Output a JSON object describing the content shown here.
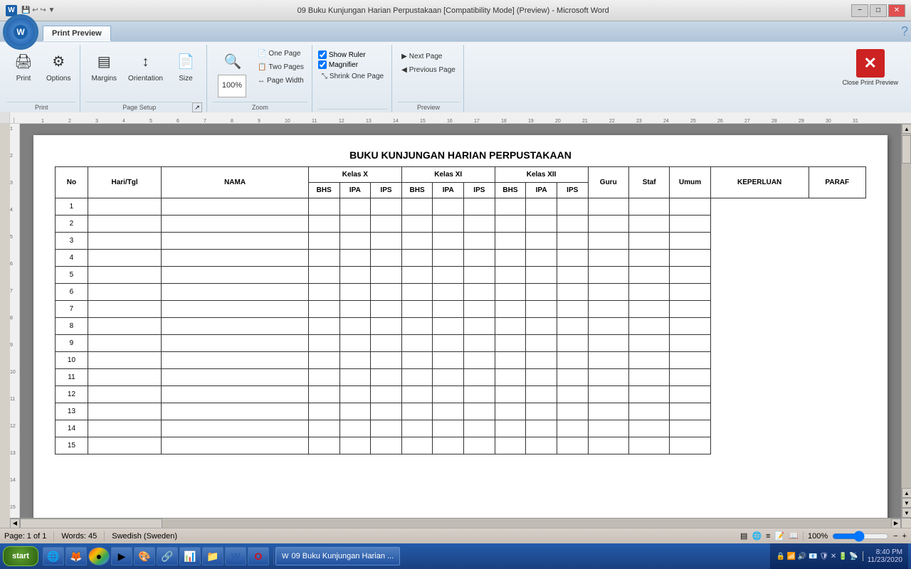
{
  "window": {
    "title": "09 Buku Kunjungan Harian Perpustakaan [Compatibility Mode] (Preview) - Microsoft Word",
    "min_label": "−",
    "max_label": "□",
    "close_label": "✕"
  },
  "ribbon_tab": {
    "label": "Print Preview"
  },
  "groups": {
    "print": {
      "label": "Print",
      "print_btn": "Print",
      "options_btn": "Options"
    },
    "page_setup": {
      "label": "Page Setup",
      "margins_btn": "Margins",
      "orientation_btn": "Orientation",
      "size_btn": "Size",
      "expand_icon": "↗"
    },
    "zoom": {
      "label": "Zoom",
      "zoom_value": "100%",
      "one_page_btn": "One Page",
      "two_pages_btn": "Two Pages",
      "page_width_btn": "Page Width"
    },
    "preview_options": {
      "show_ruler_label": "Show Ruler",
      "magnifier_label": "Magnifier",
      "shrink_one_page_label": "Shrink One Page"
    },
    "navigation": {
      "label": "Preview",
      "next_page_btn": "Next Page",
      "previous_page_btn": "Previous Page"
    },
    "close_preview": {
      "label": "Close Print Preview",
      "icon": "✕"
    }
  },
  "document": {
    "title": "BUKU KUNJUNGAN HARIAN PERPUSTAKAAN",
    "table": {
      "headers_main": [
        "No",
        "Hari/Tgl",
        "NAMA",
        "Kelas X",
        "Kelas XI",
        "Kelas XII",
        "Guru",
        "Staf",
        "Umum",
        "KEPERLUAN",
        "PARAF"
      ],
      "headers_sub": [
        "BHS",
        "IPA",
        "IPS",
        "BHS",
        "IPA",
        "IPS",
        "BHS",
        "IPA",
        "IPS"
      ],
      "rows": 15
    }
  },
  "status_bar": {
    "page_info": "Page: 1 of 1",
    "words": "Words: 45",
    "language": "Swedish (Sweden)",
    "zoom_value": "100%"
  },
  "taskbar": {
    "start_label": "start",
    "active_window": "09 Buku Kunjungan Harian ...",
    "time": "8:40 PM",
    "date": "11/23/2020"
  }
}
